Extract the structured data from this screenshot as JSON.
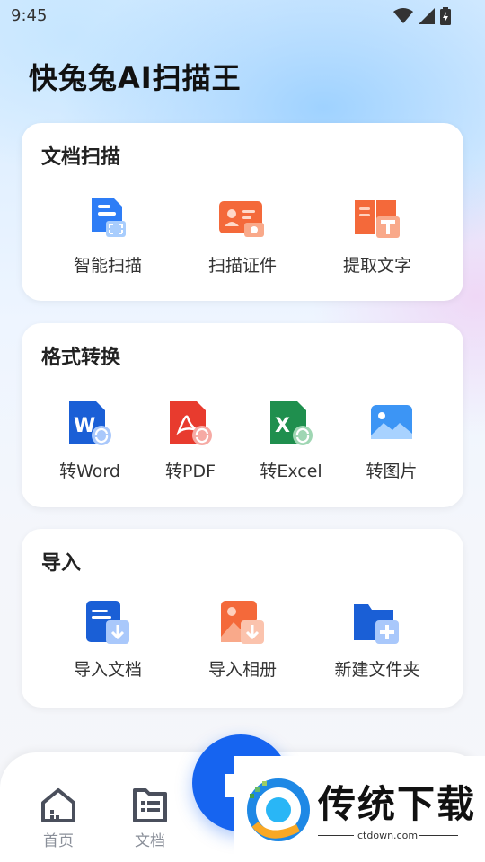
{
  "status_bar": {
    "time": "9:45"
  },
  "app_title": "快兔兔AI扫描王",
  "sections": {
    "scan": {
      "title": "文档扫描",
      "items": [
        {
          "label": "智能扫描",
          "icon": "smart-scan-icon"
        },
        {
          "label": "扫描证件",
          "icon": "id-card-icon"
        },
        {
          "label": "提取文字",
          "icon": "extract-text-icon"
        }
      ]
    },
    "convert": {
      "title": "格式转换",
      "items": [
        {
          "label": "转Word",
          "icon": "word-icon"
        },
        {
          "label": "转PDF",
          "icon": "pdf-icon"
        },
        {
          "label": "转Excel",
          "icon": "excel-icon"
        },
        {
          "label": "转图片",
          "icon": "image-icon"
        }
      ]
    },
    "import": {
      "title": "导入",
      "items": [
        {
          "label": "导入文档",
          "icon": "import-doc-icon"
        },
        {
          "label": "导入相册",
          "icon": "import-album-icon"
        },
        {
          "label": "新建文件夹",
          "icon": "new-folder-icon"
        }
      ]
    }
  },
  "bottom_nav": {
    "home": "首页",
    "docs": "文档"
  },
  "watermark": {
    "text": "传统下载",
    "url": "ctdown.com"
  },
  "colors": {
    "accent": "#1664f0",
    "word": "#1a5fd6",
    "pdf": "#e83b2e",
    "excel": "#1f8f4e",
    "orange": "#f4693a"
  }
}
